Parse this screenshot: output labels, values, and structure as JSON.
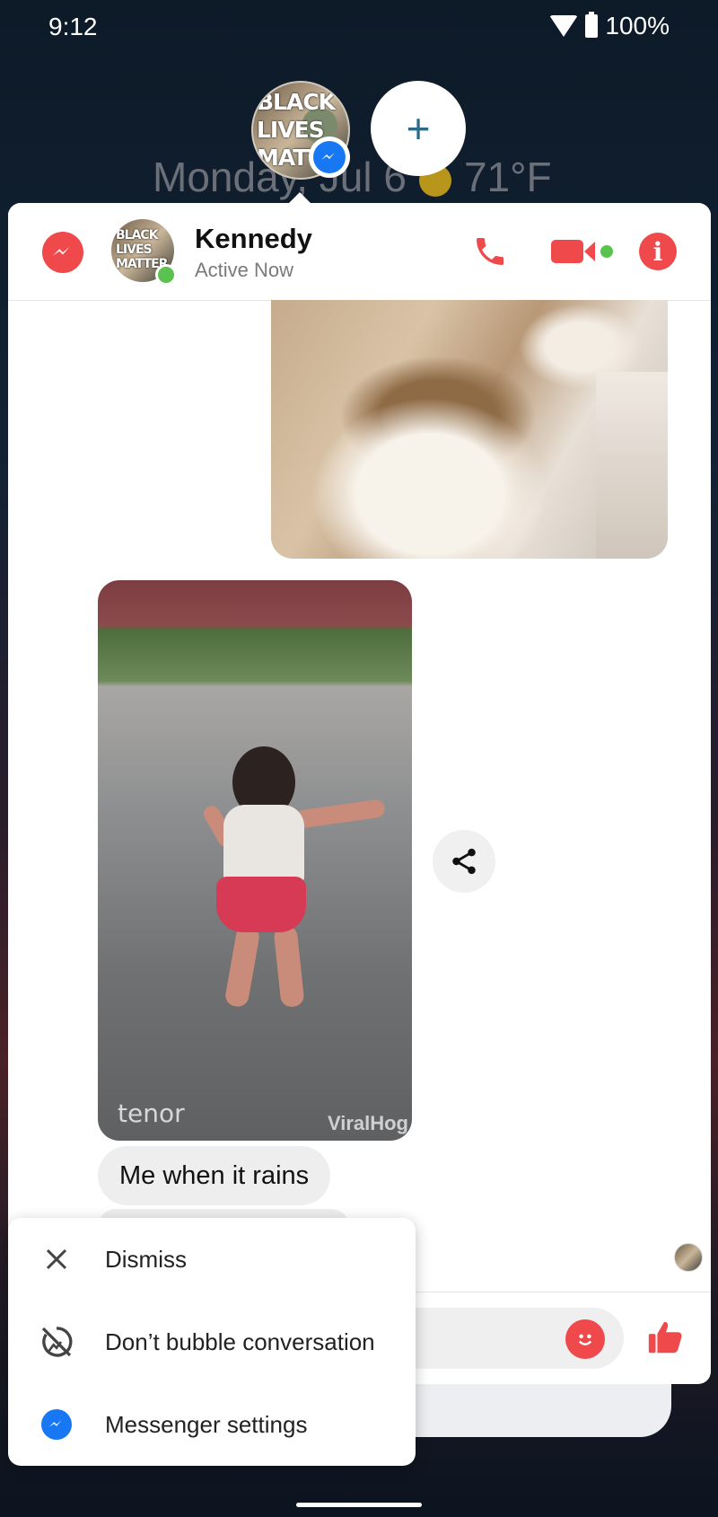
{
  "status_bar": {
    "time": "9:12",
    "battery": "100%"
  },
  "home": {
    "date": "Monday, Jul 6",
    "temperature": "71°F"
  },
  "bubbles": {
    "avatar_text": "BLACK LIVES MATTER",
    "add_label": "+"
  },
  "chat": {
    "contact_name": "Kennedy",
    "contact_status": "Active Now",
    "message_text": "Me when it rains",
    "gif_watermarks": {
      "tenor": "tenor",
      "viralhog": "ViralHog"
    }
  },
  "menu": {
    "items": [
      {
        "label": "Dismiss",
        "icon": "close-icon"
      },
      {
        "label": "Don’t bubble conversation",
        "icon": "bubble-off-icon"
      },
      {
        "label": "Messenger settings",
        "icon": "messenger-icon"
      }
    ]
  },
  "colors": {
    "messenger_red": "#f0494b",
    "messenger_blue": "#1877f2",
    "online_green": "#5ac24e"
  }
}
